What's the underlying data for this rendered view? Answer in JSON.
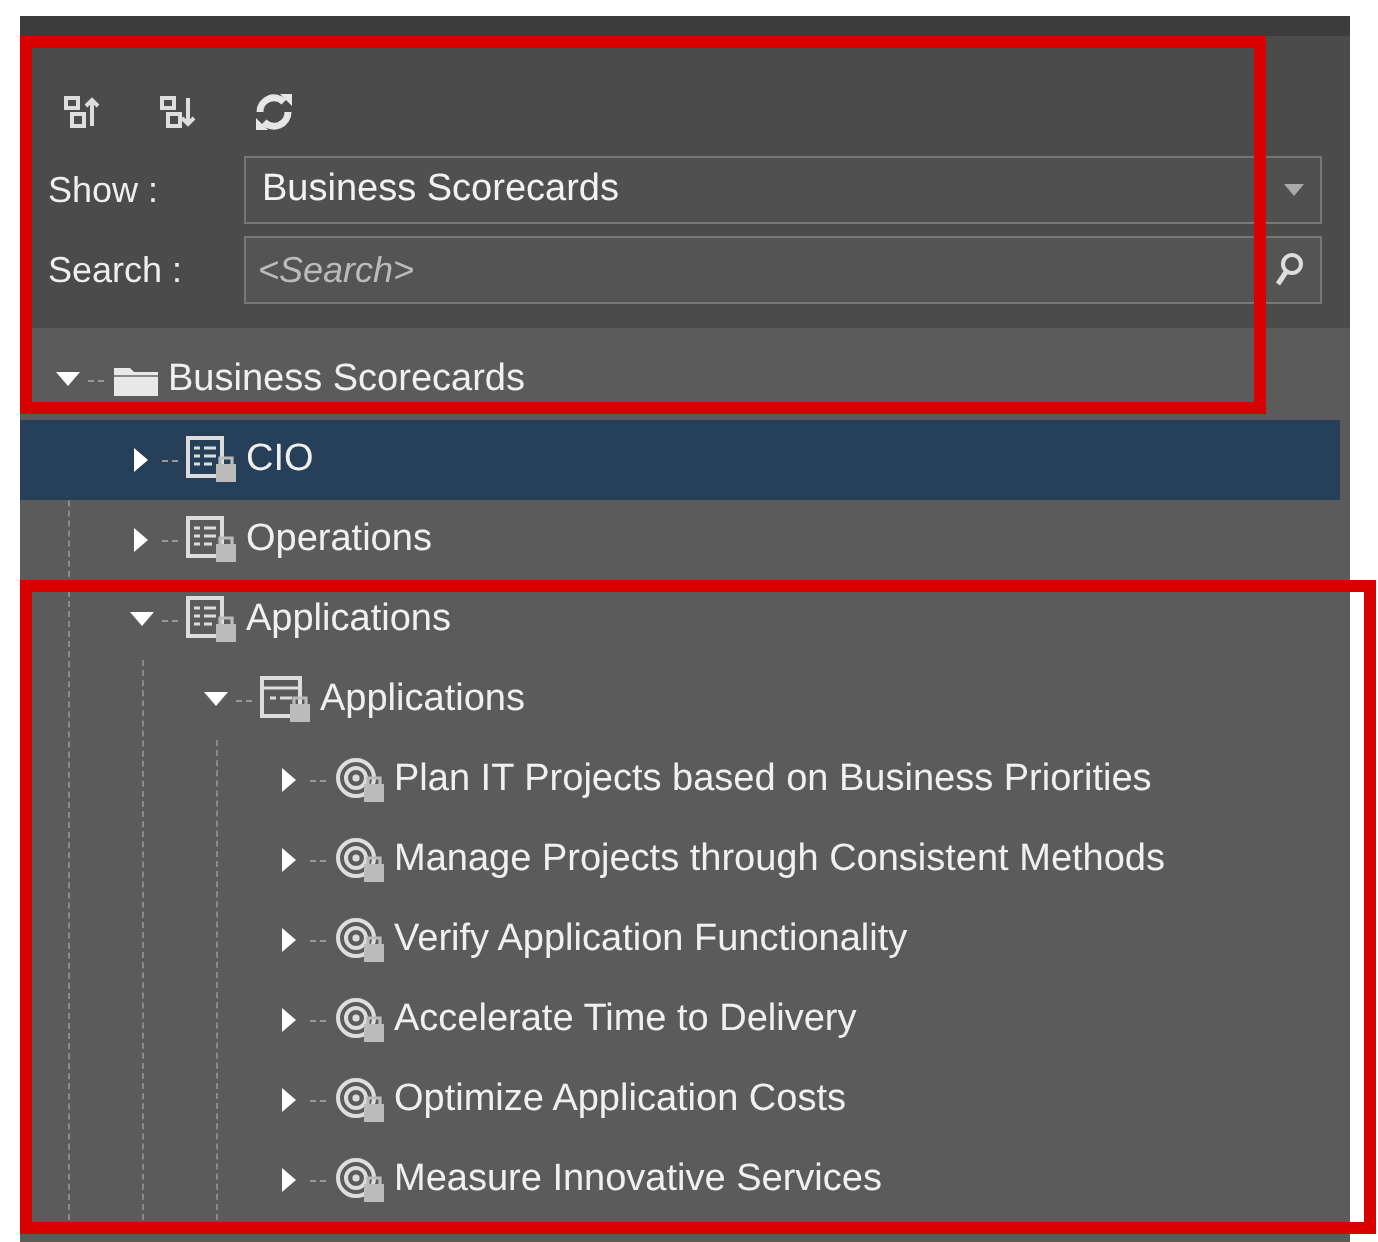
{
  "toolbar": {
    "buttons": [
      {
        "kind": "expand-all"
      },
      {
        "kind": "collapse-all"
      },
      {
        "kind": "refresh"
      }
    ]
  },
  "show": {
    "label": "Show :",
    "value": "Business Scorecards"
  },
  "search": {
    "label": "Search :",
    "placeholder": "<Search>"
  },
  "tree": [
    {
      "label": "Business Scorecards",
      "kind": "folder",
      "expanded": true,
      "selected": false,
      "children": [
        {
          "label": "CIO",
          "kind": "scorecard",
          "expanded": false,
          "selected": true
        },
        {
          "label": "Operations",
          "kind": "scorecard",
          "expanded": false,
          "selected": false
        },
        {
          "label": "Applications",
          "kind": "scorecard",
          "expanded": true,
          "selected": false,
          "children": [
            {
              "label": "Applications",
              "kind": "perspective",
              "expanded": true,
              "selected": false,
              "children": [
                {
                  "label": "Plan IT Projects based on Business Priorities",
                  "kind": "objective",
                  "expanded": false,
                  "selected": false
                },
                {
                  "label": "Manage Projects through Consistent Methods",
                  "kind": "objective",
                  "expanded": false,
                  "selected": false
                },
                {
                  "label": "Verify Application Functionality",
                  "kind": "objective",
                  "expanded": false,
                  "selected": false
                },
                {
                  "label": "Accelerate Time to Delivery",
                  "kind": "objective",
                  "expanded": false,
                  "selected": false
                },
                {
                  "label": "Optimize Application Costs",
                  "kind": "objective",
                  "expanded": false,
                  "selected": false
                },
                {
                  "label": "Measure Innovative Services",
                  "kind": "objective",
                  "expanded": false,
                  "selected": false
                }
              ]
            }
          ]
        }
      ]
    }
  ],
  "highlight_frames": [
    {
      "kind": "frame"
    },
    {
      "kind": "frame"
    }
  ]
}
